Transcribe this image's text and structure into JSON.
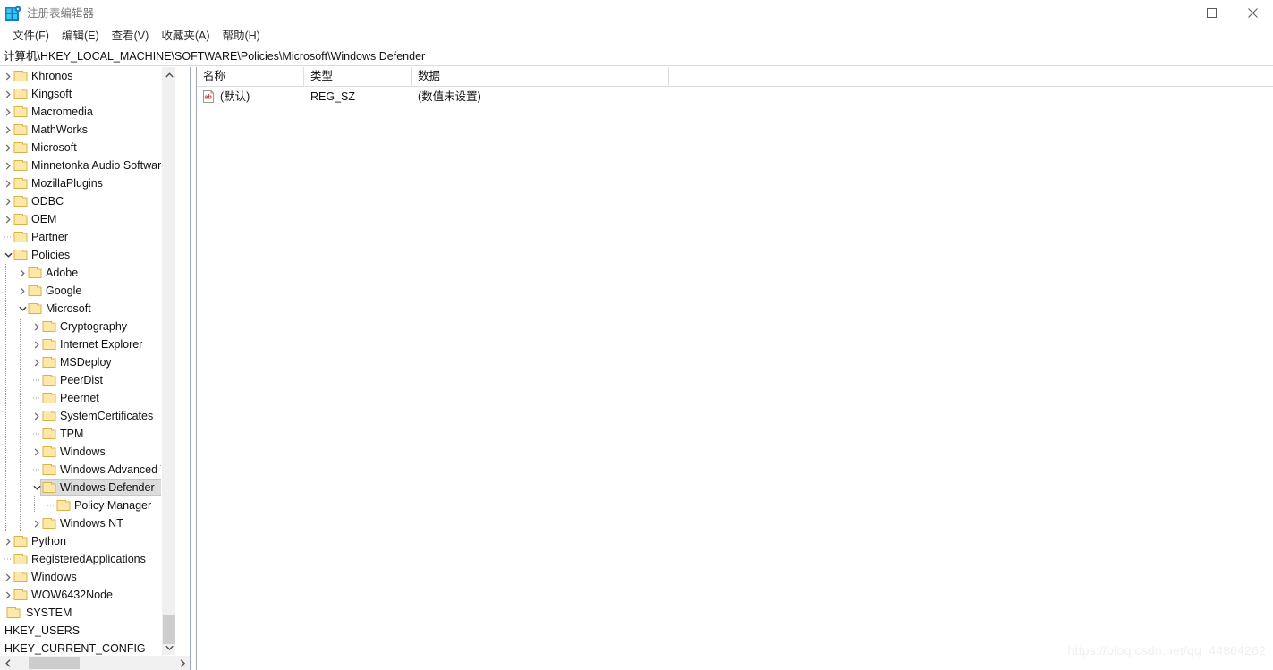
{
  "window": {
    "title": "注册表编辑器",
    "icon": "registry-editor-icon",
    "controls": {
      "minimize": "minimize-icon",
      "maximize": "maximize-icon",
      "close": "close-icon"
    }
  },
  "menubar": {
    "items": [
      {
        "label": "文件(F)"
      },
      {
        "label": "编辑(E)"
      },
      {
        "label": "查看(V)"
      },
      {
        "label": "收藏夹(A)"
      },
      {
        "label": "帮助(H)"
      }
    ]
  },
  "address": {
    "path": "计算机\\HKEY_LOCAL_MACHINE\\SOFTWARE\\Policies\\Microsoft\\Windows Defender"
  },
  "tree": {
    "nodes": [
      {
        "label": "Khronos",
        "level": 1,
        "state": "collapsed",
        "icon": "folder-icon"
      },
      {
        "label": "Kingsoft",
        "level": 1,
        "state": "collapsed",
        "icon": "folder-icon"
      },
      {
        "label": "Macromedia",
        "level": 1,
        "state": "collapsed",
        "icon": "folder-icon"
      },
      {
        "label": "MathWorks",
        "level": 1,
        "state": "collapsed",
        "icon": "folder-icon"
      },
      {
        "label": "Microsoft",
        "level": 1,
        "state": "collapsed",
        "icon": "folder-icon"
      },
      {
        "label": "Minnetonka Audio Software",
        "level": 1,
        "state": "collapsed",
        "icon": "folder-icon"
      },
      {
        "label": "MozillaPlugins",
        "level": 1,
        "state": "collapsed",
        "icon": "folder-icon"
      },
      {
        "label": "ODBC",
        "level": 1,
        "state": "collapsed",
        "icon": "folder-icon"
      },
      {
        "label": "OEM",
        "level": 1,
        "state": "collapsed",
        "icon": "folder-icon"
      },
      {
        "label": "Partner",
        "level": 1,
        "state": "leaf",
        "icon": "folder-icon"
      },
      {
        "label": "Policies",
        "level": 1,
        "state": "expanded",
        "icon": "folder-icon"
      },
      {
        "label": "Adobe",
        "level": 2,
        "state": "collapsed",
        "icon": "folder-icon"
      },
      {
        "label": "Google",
        "level": 2,
        "state": "collapsed",
        "icon": "folder-icon"
      },
      {
        "label": "Microsoft",
        "level": 2,
        "state": "expanded",
        "icon": "folder-icon"
      },
      {
        "label": "Cryptography",
        "level": 3,
        "state": "collapsed",
        "icon": "folder-icon"
      },
      {
        "label": "Internet Explorer",
        "level": 3,
        "state": "collapsed",
        "icon": "folder-icon"
      },
      {
        "label": "MSDeploy",
        "level": 3,
        "state": "collapsed",
        "icon": "folder-icon"
      },
      {
        "label": "PeerDist",
        "level": 3,
        "state": "leaf",
        "icon": "folder-icon"
      },
      {
        "label": "Peernet",
        "level": 3,
        "state": "leaf",
        "icon": "folder-icon"
      },
      {
        "label": "SystemCertificates",
        "level": 3,
        "state": "collapsed",
        "icon": "folder-icon"
      },
      {
        "label": "TPM",
        "level": 3,
        "state": "leaf",
        "icon": "folder-icon"
      },
      {
        "label": "Windows",
        "level": 3,
        "state": "collapsed",
        "icon": "folder-icon"
      },
      {
        "label": "Windows Advanced Th",
        "level": 3,
        "state": "leaf",
        "icon": "folder-icon"
      },
      {
        "label": "Windows Defender",
        "level": 3,
        "state": "expanded",
        "icon": "folder-icon",
        "selected": true
      },
      {
        "label": "Policy Manager",
        "level": 4,
        "state": "leaf",
        "icon": "folder-icon"
      },
      {
        "label": "Windows NT",
        "level": 3,
        "state": "collapsed",
        "icon": "folder-icon"
      },
      {
        "label": "Python",
        "level": 1,
        "state": "collapsed",
        "icon": "folder-icon"
      },
      {
        "label": "RegisteredApplications",
        "level": 1,
        "state": "leaf",
        "icon": "folder-icon"
      },
      {
        "label": "Windows",
        "level": 1,
        "state": "collapsed",
        "icon": "folder-icon"
      },
      {
        "label": "WOW6432Node",
        "level": 1,
        "state": "collapsed",
        "icon": "folder-icon"
      },
      {
        "label": "SYSTEM",
        "level": 0,
        "state": "leaf",
        "icon": "folder-icon"
      },
      {
        "label": "HKEY_USERS",
        "level": 0,
        "state": "none",
        "icon": "none"
      },
      {
        "label": "HKEY_CURRENT_CONFIG",
        "level": 0,
        "state": "none",
        "icon": "none"
      }
    ],
    "scrollbars": {
      "vertical_up": "scroll-up-icon",
      "vertical_down": "scroll-down-icon",
      "horizontal_left": "scroll-left-icon",
      "horizontal_right": "scroll-right-icon"
    }
  },
  "list": {
    "columns": [
      {
        "label": "名称"
      },
      {
        "label": "类型"
      },
      {
        "label": "数据"
      }
    ],
    "rows": [
      {
        "icon": "string-value-icon",
        "name": "(默认)",
        "type": "REG_SZ",
        "data": "(数值未设置)"
      }
    ]
  },
  "watermark": {
    "text": "https://blog.csdn.net/qq_44864262"
  }
}
